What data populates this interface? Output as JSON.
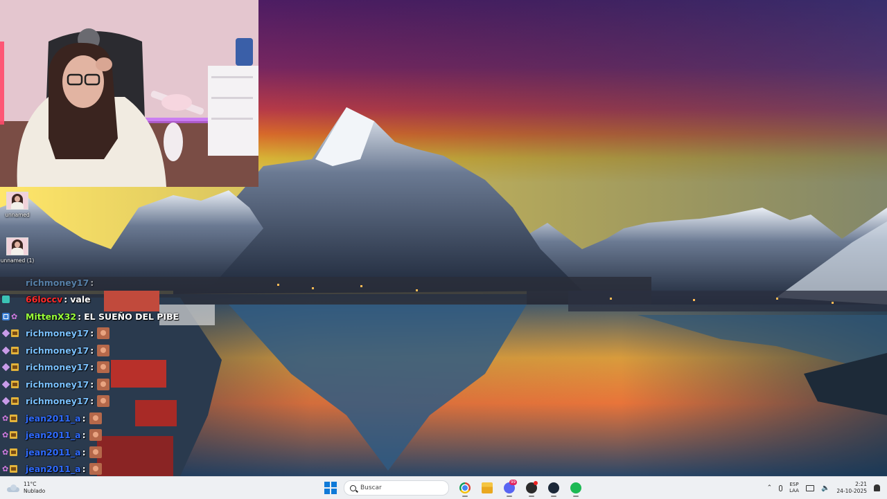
{
  "desktop": {
    "icons": [
      {
        "label": "unnamed"
      },
      {
        "label": "unnamed (1)"
      }
    ]
  },
  "chat": {
    "messages": [
      {
        "user": "richmoney17",
        "colon": ":",
        "message": "",
        "color": "#7ac1ff",
        "badges": [],
        "faded": true
      },
      {
        "user": "66loccv",
        "colon": ":",
        "message": "vale",
        "color": "#ff2a2a",
        "badges": [
          "gp-icon"
        ]
      },
      {
        "user": "MittenX32",
        "colon": ":",
        "message": "EL SUEÑO DEL PIBE",
        "color": "#9aff3a",
        "badges": [
          "prime-icon",
          "flower-icon"
        ]
      },
      {
        "user": "richmoney17",
        "colon": ":",
        "message": "",
        "color": "#7ac1ff",
        "badges": [
          "diamond-icon",
          "crown-icon"
        ],
        "emote": true
      },
      {
        "user": "richmoney17",
        "colon": ":",
        "message": "",
        "color": "#7ac1ff",
        "badges": [
          "diamond-icon",
          "crown-icon"
        ],
        "emote": true
      },
      {
        "user": "richmoney17",
        "colon": ":",
        "message": "",
        "color": "#7ac1ff",
        "badges": [
          "diamond-icon",
          "crown-icon"
        ],
        "emote": true
      },
      {
        "user": "richmoney17",
        "colon": ":",
        "message": "",
        "color": "#7ac1ff",
        "badges": [
          "diamond-icon",
          "crown-icon"
        ],
        "emote": true
      },
      {
        "user": "richmoney17",
        "colon": ":",
        "message": "",
        "color": "#7ac1ff",
        "badges": [
          "diamond-icon",
          "crown-icon"
        ],
        "emote": true
      },
      {
        "user": "jean2011_a",
        "colon": ":",
        "message": "",
        "color": "#2f6bff",
        "badges": [
          "flower-icon",
          "crown-icon"
        ],
        "emote": true
      },
      {
        "user": "jean2011_a",
        "colon": ":",
        "message": "",
        "color": "#2f6bff",
        "badges": [
          "flower-icon",
          "crown-icon"
        ],
        "emote": true
      },
      {
        "user": "jean2011_a",
        "colon": ":",
        "message": "",
        "color": "#2f6bff",
        "badges": [
          "flower-icon",
          "crown-icon"
        ],
        "emote": true
      },
      {
        "user": "jean2011_a",
        "colon": ":",
        "message": "",
        "color": "#2f6bff",
        "badges": [
          "flower-icon",
          "crown-icon"
        ],
        "emote": true
      },
      {
        "user": "jean2011_a",
        "colon": ":",
        "message": "",
        "color": "#2f6bff",
        "badges": [
          "flower-icon",
          "crown-icon"
        ],
        "emote": true
      }
    ]
  },
  "taskbar": {
    "weather": {
      "temp": "11°C",
      "condition": "Nublado",
      "icon": "cloud-icon"
    },
    "search": {
      "placeholder": "Buscar"
    },
    "apps": [
      {
        "name": "chrome",
        "icon": "chrome-icon"
      },
      {
        "name": "file-explorer",
        "icon": "folder-icon"
      },
      {
        "name": "discord",
        "icon": "discord-icon",
        "badge": "99"
      },
      {
        "name": "obs",
        "icon": "obs-icon",
        "recording": true
      },
      {
        "name": "steam",
        "icon": "steam-icon"
      },
      {
        "name": "spotify",
        "icon": "spotify-icon"
      }
    ],
    "tray": {
      "lang_top": "ESP",
      "lang_bottom": "LAA",
      "time": "2:21",
      "date": "24-10-2025"
    }
  },
  "colors": {
    "accent": "#0f7ad8",
    "sky_top": "#4a1f6e",
    "sunset": "#ff9a2a"
  }
}
